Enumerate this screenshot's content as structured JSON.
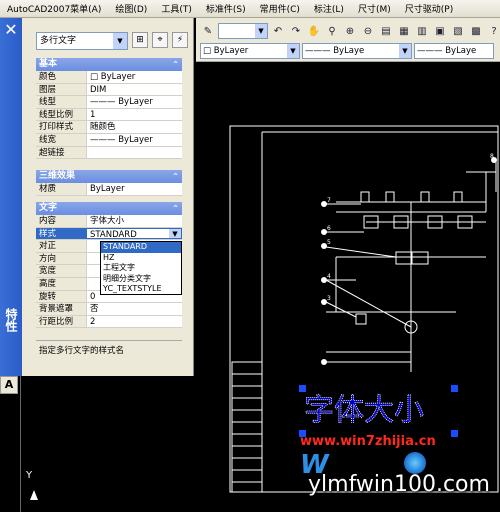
{
  "menubar": {
    "items": [
      "AutoCAD2007菜单(A)",
      "绘图(D)",
      "工具(T)",
      "标准件(S)",
      "常用件(C)",
      "标注(L)",
      "尺寸(M)",
      "尺寸驱动(P)"
    ]
  },
  "toolbar": {
    "layer_combo": "ByLayer",
    "linetype_combo": "ByLaye"
  },
  "dock": {
    "title": "特性",
    "close_glyph": "✕"
  },
  "properties": {
    "object_type": "多行文字",
    "sections": {
      "basic": {
        "title": "基本",
        "rows": [
          {
            "k": "颜色",
            "v": "□ ByLayer"
          },
          {
            "k": "图层",
            "v": "DIM"
          },
          {
            "k": "线型",
            "v": "——— ByLayer"
          },
          {
            "k": "线型比例",
            "v": "1"
          },
          {
            "k": "打印样式",
            "v": "随颜色"
          },
          {
            "k": "线宽",
            "v": "——— ByLayer"
          },
          {
            "k": "超链接",
            "v": ""
          }
        ]
      },
      "three_d": {
        "title": "三维效果",
        "rows": [
          {
            "k": "材质",
            "v": "ByLayer"
          }
        ]
      },
      "text": {
        "title": "文字",
        "rows": [
          {
            "k": "内容",
            "v": "字体大小"
          },
          {
            "k": "样式",
            "v": "STANDARD"
          },
          {
            "k": "对正",
            "v": ""
          },
          {
            "k": "方向",
            "v": ""
          },
          {
            "k": "宽度",
            "v": ""
          },
          {
            "k": "高度",
            "v": ""
          },
          {
            "k": "旋转",
            "v": "0"
          },
          {
            "k": "背景遮罩",
            "v": "否"
          },
          {
            "k": "行距比例",
            "v": "2"
          }
        ]
      }
    },
    "style_dropdown": [
      "STANDARD",
      "HZ",
      "工程文字",
      "明细分类文字",
      "YC_TEXTSTYLE"
    ],
    "description": "指定多行文字的样式名"
  },
  "drawing": {
    "text_label": "字体大小",
    "balloons": [
      "7",
      "6",
      "5",
      "4",
      "3",
      "8"
    ]
  },
  "status": {
    "a_tab": "A",
    "ucs_y": "Y"
  },
  "watermark": {
    "site1": "www.win7zhijia.cn",
    "site2": "ylmfwin100.com",
    "brand": "W"
  },
  "colors": {
    "dock": "#2a5cc7",
    "section_header": "#6a8ee0",
    "selection": "#316ac5",
    "watermark_red": "#ff2a1c"
  }
}
